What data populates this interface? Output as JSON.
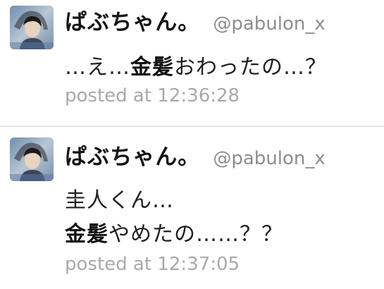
{
  "tweets": [
    {
      "display_name": "ぱぶちゃん。",
      "username": "@pabulon_x",
      "lines": [
        [
          {
            "text": "…え…",
            "bold": false
          },
          {
            "text": "金髪",
            "bold": true
          },
          {
            "text": "おわったの…？",
            "bold": false
          }
        ]
      ],
      "timestamp": "posted at 12:36:28"
    },
    {
      "display_name": "ぱぶちゃん。",
      "username": "@pabulon_x",
      "lines": [
        [
          {
            "text": "圭人くん…",
            "bold": false
          }
        ],
        [
          {
            "text": "金髪",
            "bold": true
          },
          {
            "text": "やめたの……？？",
            "bold": false
          }
        ]
      ],
      "timestamp": "posted at 12:37:05"
    }
  ],
  "colors": {
    "username": "#8d8d8d",
    "timestamp": "#a9a9a9",
    "divider": "#e4e4e4"
  },
  "icons": {
    "avatar": "avatar-photo-icon"
  }
}
